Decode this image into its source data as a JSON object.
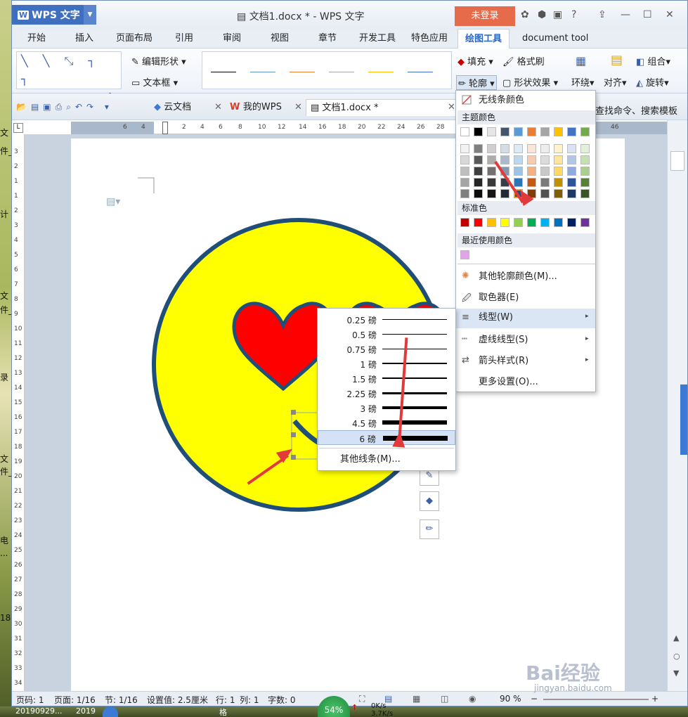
{
  "desktop_labels": [
    "文",
    "件_2",
    "计",
    "文",
    "件_8",
    "录",
    "文",
    "件_4",
    "电",
    "...",
    "18"
  ],
  "taskbar": {
    "items": [
      "20190929...",
      "2019",
      "格"
    ],
    "gauge": "54%",
    "net_up": "0K/s",
    "net_down": "3.7K/s"
  },
  "app": {
    "name": "WPS 文字",
    "doc_title": "文档1.docx * - WPS 文字",
    "login": "未登录"
  },
  "tabs": [
    "开始",
    "插入",
    "页面布局",
    "引用",
    "审阅",
    "视图",
    "章节",
    "开发工具",
    "特色应用",
    "绘图工具",
    "document tool"
  ],
  "active_tab": "绘图工具",
  "ribbon": {
    "edit_shape": "编辑形状",
    "text_box": "文本框",
    "fill": "填充",
    "format_brush": "格式刷",
    "outline": "轮廓",
    "shape_effect": "形状效果",
    "wrap": "环绕",
    "align": "对齐",
    "group": "组合",
    "rotate": "旋转",
    "search_hint": "查找命令、搜索模板"
  },
  "doc_tabs": [
    "云文档",
    "我的WPS",
    "文档1.docx *"
  ],
  "ruler": {
    "h": [
      "6",
      "4",
      "2",
      "2",
      "4",
      "6",
      "8",
      "10",
      "12",
      "14",
      "16",
      "18",
      "20",
      "22",
      "24",
      "26",
      "28",
      "30",
      "46"
    ],
    "v": [
      "3",
      "2",
      "1",
      "1",
      "2",
      "3",
      "4",
      "5",
      "6",
      "7",
      "8",
      "9",
      "10",
      "11",
      "12",
      "13",
      "14",
      "15",
      "16",
      "17",
      "18",
      "19",
      "20",
      "21",
      "22",
      "23",
      "24",
      "25",
      "26",
      "27",
      "28",
      "29",
      "30",
      "31",
      "32",
      "33",
      "34"
    ]
  },
  "status": {
    "page_num": "页码: 1",
    "pages": "页面: 1/16",
    "section": "节: 1/16",
    "setting": "设置值: 2.5厘米",
    "row": "行: 1",
    "col": "列: 1",
    "chars": "字数: 0",
    "zoom": "90 %"
  },
  "outline_menu": {
    "no_color": "无线条颜色",
    "theme_header": "主题颜色",
    "theme_top": [
      "#ffffff",
      "#000000",
      "#e7e6e6",
      "#44546a",
      "#5b9bd5",
      "#ed7d31",
      "#a5a5a5",
      "#ffc000",
      "#4472c4",
      "#70ad47"
    ],
    "theme_shades": [
      [
        "#f2f2f2",
        "#7f7f7f",
        "#d0cece",
        "#d6dce4",
        "#deebf6",
        "#fbe5d5",
        "#ededed",
        "#fff2cc",
        "#dae3f3",
        "#e2efd9"
      ],
      [
        "#d8d8d8",
        "#595959",
        "#aeabab",
        "#adb9ca",
        "#bdd7ee",
        "#f8cbad",
        "#dbdbdb",
        "#fee599",
        "#b4c6e7",
        "#c5e0b3"
      ],
      [
        "#bfbfbf",
        "#3f3f3f",
        "#757070",
        "#8496b0",
        "#9dc3e6",
        "#f4b183",
        "#c9c9c9",
        "#ffd966",
        "#8faadc",
        "#a8d08d"
      ],
      [
        "#a5a5a5",
        "#262626",
        "#3a3838",
        "#323f4f",
        "#2e75b5",
        "#c55a11",
        "#7b7b7b",
        "#bf9000",
        "#2f5496",
        "#538135"
      ],
      [
        "#7f7f7f",
        "#0c0c0c",
        "#171616",
        "#222a35",
        "#1f4e79",
        "#843c0b",
        "#525252",
        "#7f6000",
        "#203864",
        "#375623"
      ]
    ],
    "standard_header": "标准色",
    "standard": [
      "#c00000",
      "#ff0000",
      "#ffc000",
      "#ffff00",
      "#92d050",
      "#00b050",
      "#00b0f0",
      "#0070c0",
      "#002060",
      "#7030a0"
    ],
    "recent_header": "最近使用颜色",
    "recent": [
      "#e3a3e8"
    ],
    "more_colors": "其他轮廓颜色(M)...",
    "picker": "取色器(E)",
    "line_type": "线型(W)",
    "dash_type": "虚线线型(S)",
    "arrow_style": "箭头样式(R)",
    "more_settings": "更多设置(O)..."
  },
  "weight_menu": {
    "items": [
      "0.25 磅",
      "0.5 磅",
      "0.75 磅",
      "1 磅",
      "1.5 磅",
      "2.25 磅",
      "3 磅",
      "4.5 磅",
      "6 磅"
    ],
    "selected": "6 磅",
    "more": "其他线条(M)..."
  },
  "watermark": {
    "brand": "Bai经验",
    "url": "jingyan.baidu.com"
  },
  "colors": {
    "accent": "#2a66c4",
    "login": "#e66b4a",
    "face": "#ffff00",
    "heart": "#ff0000",
    "outline": "#1f4e79",
    "arrow": "#e23a3a"
  }
}
